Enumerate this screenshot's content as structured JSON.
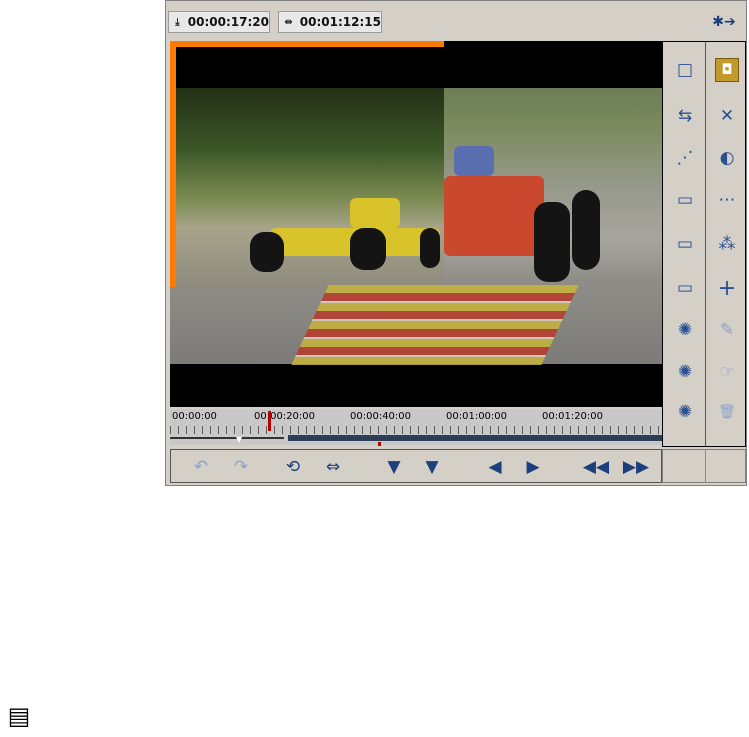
{
  "timecodes": {
    "position": {
      "icon": "download-arrow-icon",
      "value": "00:00:17:20"
    },
    "duration": {
      "icon": "duration-arrows-icon",
      "value": "00:01:12:15"
    }
  },
  "exit_icon": "exit-arrows-icon",
  "timeline": {
    "labels": [
      "00:00:00",
      "00:00:20:00",
      "00:00:40:00",
      "00:01:00:00",
      "00:01:20:00"
    ],
    "playhead_fraction": 0.2
  },
  "transport": {
    "buttons": [
      {
        "name": "undo-icon",
        "glyph": "↶",
        "enabled": false
      },
      {
        "name": "redo-icon",
        "glyph": "↷",
        "enabled": false
      },
      {
        "name": "loop-icon",
        "glyph": "⟲",
        "enabled": true
      },
      {
        "name": "trim-icon",
        "glyph": "⇔",
        "enabled": true
      },
      {
        "name": "mark-in-icon",
        "glyph": "▼",
        "enabled": true
      },
      {
        "name": "mark-out-icon",
        "glyph": "▼",
        "enabled": true
      },
      {
        "name": "step-back-icon",
        "glyph": "◀",
        "enabled": true
      },
      {
        "name": "step-forward-icon",
        "glyph": "▶",
        "enabled": true
      },
      {
        "name": "rewind-icon",
        "glyph": "◀◀",
        "enabled": true
      },
      {
        "name": "fast-forward-icon",
        "glyph": "▶▶",
        "enabled": true
      }
    ]
  },
  "tools": {
    "left": [
      {
        "name": "square-icon",
        "glyph": "□",
        "enabled": true
      },
      {
        "name": "swap-icon",
        "glyph": "⇆",
        "enabled": true
      },
      {
        "name": "nodes-icon",
        "glyph": "⋰",
        "enabled": true
      },
      {
        "name": "monitor-icon",
        "glyph": "▭",
        "enabled": true
      },
      {
        "name": "monitor-down-icon",
        "glyph": "▭",
        "enabled": true
      },
      {
        "name": "monitor-dots-icon",
        "glyph": "▭",
        "enabled": true
      },
      {
        "name": "gear-top-icon",
        "glyph": "✺",
        "enabled": true
      },
      {
        "name": "gear-mid-icon",
        "glyph": "✺",
        "enabled": true
      },
      {
        "name": "gear-bottom-icon",
        "glyph": "✺",
        "enabled": true
      }
    ],
    "right": [
      {
        "name": "highlight-icon",
        "glyph": "◘",
        "enabled": true,
        "active": true
      },
      {
        "name": "cross-nodes-icon",
        "glyph": "✕",
        "enabled": true
      },
      {
        "name": "half-circle-icon",
        "glyph": "◐",
        "enabled": true
      },
      {
        "name": "single-node-icon",
        "glyph": "⋯",
        "enabled": true
      },
      {
        "name": "multi-node-icon",
        "glyph": "⁂",
        "enabled": true
      },
      {
        "name": "plus-icon",
        "glyph": "+",
        "enabled": true
      },
      {
        "name": "pen-icon",
        "glyph": "✎",
        "enabled": false
      },
      {
        "name": "pointer-icon",
        "glyph": "☞",
        "enabled": false
      },
      {
        "name": "trash-icon",
        "glyph": "🗑",
        "enabled": false
      }
    ]
  },
  "note_icon": "note-list-icon"
}
